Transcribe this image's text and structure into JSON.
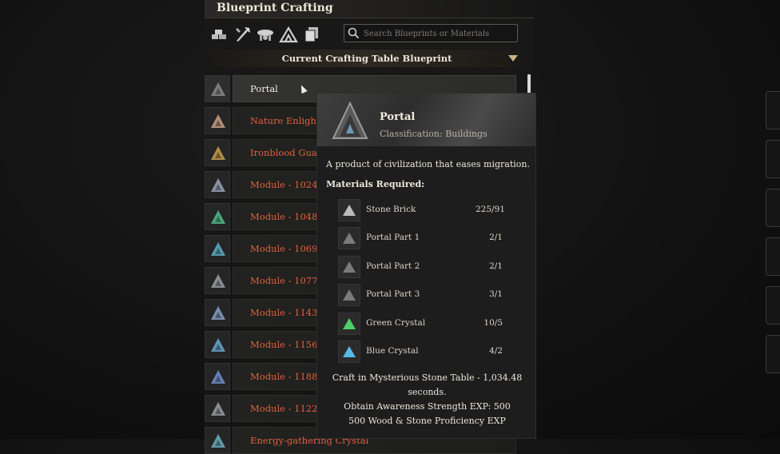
{
  "window": {
    "title": "Blueprint Crafting"
  },
  "categories": [
    {
      "icon": "stone-pile-icon"
    },
    {
      "icon": "tools-icon"
    },
    {
      "icon": "workbench-icon"
    },
    {
      "icon": "tent-icon"
    },
    {
      "icon": "cards-icon"
    }
  ],
  "search": {
    "placeholder": "Search Blueprints or Materials"
  },
  "dropdown": {
    "label": "Current Crafting Table Blueprint"
  },
  "blueprints": [
    {
      "name": "Portal",
      "selected": true,
      "color": "#8b8b8b"
    },
    {
      "name": "Nature Enlightenment",
      "color": "#c9a084"
    },
    {
      "name": "Ironblood Guard",
      "color": "#c8a04a"
    },
    {
      "name": "Module - 1024",
      "color": "#9aa6b8"
    },
    {
      "name": "Module - 1048",
      "color": "#4fbf8a"
    },
    {
      "name": "Module - 1069",
      "color": "#5ab0c8"
    },
    {
      "name": "Module - 1077",
      "color": "#9aa0a8"
    },
    {
      "name": "Module - 1143",
      "color": "#8aa0c8"
    },
    {
      "name": "Module - 1156",
      "color": "#6aa8d0"
    },
    {
      "name": "Module - 1188",
      "color": "#7090d0"
    },
    {
      "name": "Module - 1122",
      "color": "#9aa0a8"
    },
    {
      "name": "Energy-gathering Crystal",
      "color": "#6ab0c0"
    }
  ],
  "tooltip": {
    "title": "Portal",
    "classification": "Classification: Buildings",
    "description": "A product of civilization that eases migration.",
    "materials_heading": "Materials Required:",
    "materials": [
      {
        "name": "Stone Brick",
        "qty": "225/91",
        "icon": "stone-brick-icon"
      },
      {
        "name": "Portal Part 1",
        "qty": "2/1",
        "icon": "portal-part-icon"
      },
      {
        "name": "Portal Part 2",
        "qty": "2/1",
        "icon": "portal-part-icon"
      },
      {
        "name": "Portal Part 3",
        "qty": "3/1",
        "icon": "portal-part-icon"
      },
      {
        "name": "Green Crystal",
        "qty": "10/5",
        "icon": "green-crystal-icon"
      },
      {
        "name": "Blue Crystal",
        "qty": "4/2",
        "icon": "blue-crystal-icon"
      }
    ],
    "footer": [
      "Craft in Mysterious Stone Table - 1,034.48",
      "seconds.",
      "Obtain Awareness Strength EXP: 500",
      "500 Wood & Stone Proficiency EXP"
    ]
  }
}
